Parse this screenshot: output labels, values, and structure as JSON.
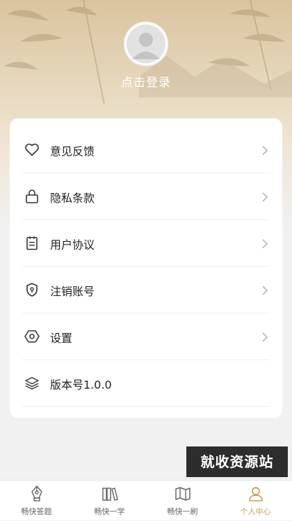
{
  "header": {
    "login_label": "点击登录"
  },
  "menu": [
    {
      "icon": "heart-icon",
      "label": "意见反馈",
      "has_arrow": true
    },
    {
      "icon": "lock-icon",
      "label": "隐私条款",
      "has_arrow": true
    },
    {
      "icon": "document-icon",
      "label": "用户协议",
      "has_arrow": true
    },
    {
      "icon": "shield-icon",
      "label": "注销账号",
      "has_arrow": true
    },
    {
      "icon": "hexagon-settings-icon",
      "label": "设置",
      "has_arrow": true
    },
    {
      "icon": "layers-icon",
      "label": "版本号1.0.0",
      "has_arrow": false
    }
  ],
  "watermark": "就收资源站",
  "tabs": [
    {
      "icon": "pen-nib-icon",
      "label": "畅快答题",
      "active": false
    },
    {
      "icon": "books-icon",
      "label": "畅快一学",
      "active": false
    },
    {
      "icon": "map-book-icon",
      "label": "畅快一刷",
      "active": false
    },
    {
      "icon": "person-icon",
      "label": "个人中心",
      "active": true
    }
  ],
  "colors": {
    "accent": "#c89b4c",
    "header_top": "#d9c49d",
    "background": "#f1f1f1"
  }
}
